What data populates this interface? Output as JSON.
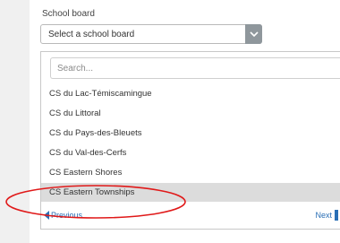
{
  "form": {
    "label": "School board",
    "select_value": "Select a school board"
  },
  "dropdown": {
    "search_placeholder": "Search...",
    "options": [
      {
        "label": "CS du Lac-Témiscamingue"
      },
      {
        "label": "CS du Littoral"
      },
      {
        "label": "CS du Pays-des-Bleuets"
      },
      {
        "label": "CS du Val-des-Cerfs"
      },
      {
        "label": "CS Eastern Shores"
      },
      {
        "label": "CS Eastern Townships"
      }
    ],
    "selected_index": 5,
    "prev_label": "Previous",
    "next_label": "Next"
  },
  "colors": {
    "accent": "#2a6fb6",
    "annotation": "#e01919",
    "selected_row": "#dcdcdc"
  },
  "icons": {
    "select_arrow": "chevron-down-icon",
    "prev": "triangle-left-icon",
    "next": "triangle-right-icon"
  }
}
